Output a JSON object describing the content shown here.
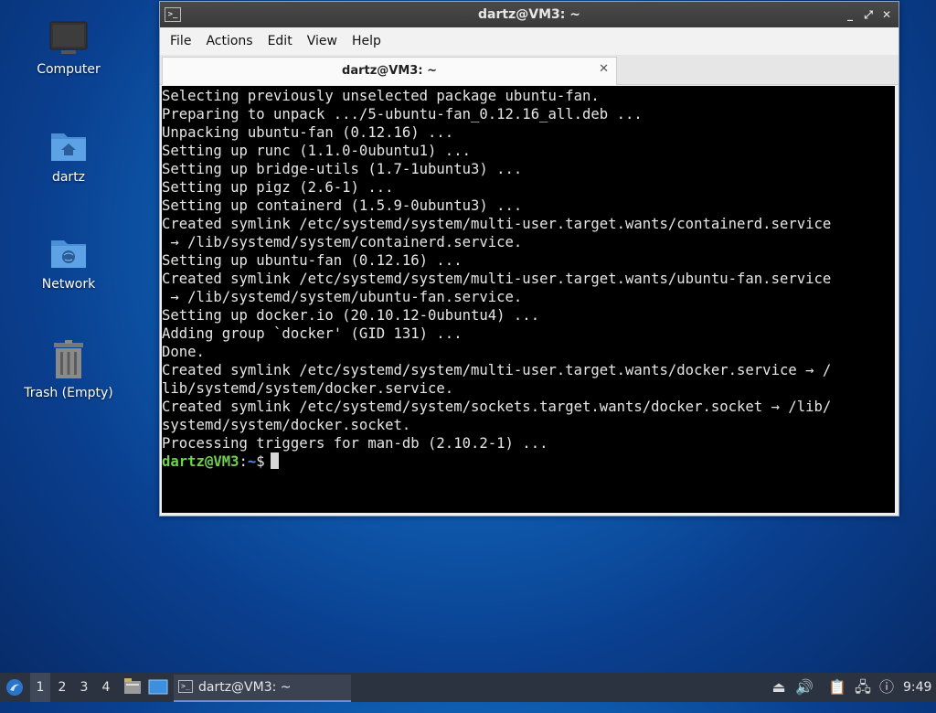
{
  "desktop": {
    "icons": [
      {
        "label": "Computer"
      },
      {
        "label": "dartz"
      },
      {
        "label": "Network"
      },
      {
        "label": "Trash (Empty)"
      }
    ]
  },
  "window": {
    "title": "dartz@VM3: ~",
    "controls": {
      "minimize": "_",
      "maximize": "⤢",
      "close": "✕"
    },
    "menu": [
      "File",
      "Actions",
      "Edit",
      "View",
      "Help"
    ],
    "tab": {
      "label": "dartz@VM3: ~",
      "close": "✕"
    },
    "terminal": {
      "lines": [
        "Selecting previously unselected package ubuntu-fan.",
        "Preparing to unpack .../5-ubuntu-fan_0.12.16_all.deb ...",
        "Unpacking ubuntu-fan (0.12.16) ...",
        "Setting up runc (1.1.0-0ubuntu1) ...",
        "Setting up bridge-utils (1.7-1ubuntu3) ...",
        "Setting up pigz (2.6-1) ...",
        "Setting up containerd (1.5.9-0ubuntu3) ...",
        "Created symlink /etc/systemd/system/multi-user.target.wants/containerd.service",
        " → /lib/systemd/system/containerd.service.",
        "Setting up ubuntu-fan (0.12.16) ...",
        "Created symlink /etc/systemd/system/multi-user.target.wants/ubuntu-fan.service",
        " → /lib/systemd/system/ubuntu-fan.service.",
        "Setting up docker.io (20.10.12-0ubuntu4) ...",
        "Adding group `docker' (GID 131) ...",
        "Done.",
        "Created symlink /etc/systemd/system/multi-user.target.wants/docker.service → /",
        "lib/systemd/system/docker.service.",
        "Created symlink /etc/systemd/system/sockets.target.wants/docker.socket → /lib/",
        "systemd/system/docker.socket.",
        "Processing triggers for man-db (2.10.2-1) ..."
      ],
      "prompt": {
        "user": "dartz@VM3",
        "sep": ":",
        "path": "~",
        "symbol": "$"
      }
    }
  },
  "taskbar": {
    "workspaces": [
      "1",
      "2",
      "3",
      "4"
    ],
    "active_task": "dartz@VM3: ~",
    "clock": "9:49"
  }
}
